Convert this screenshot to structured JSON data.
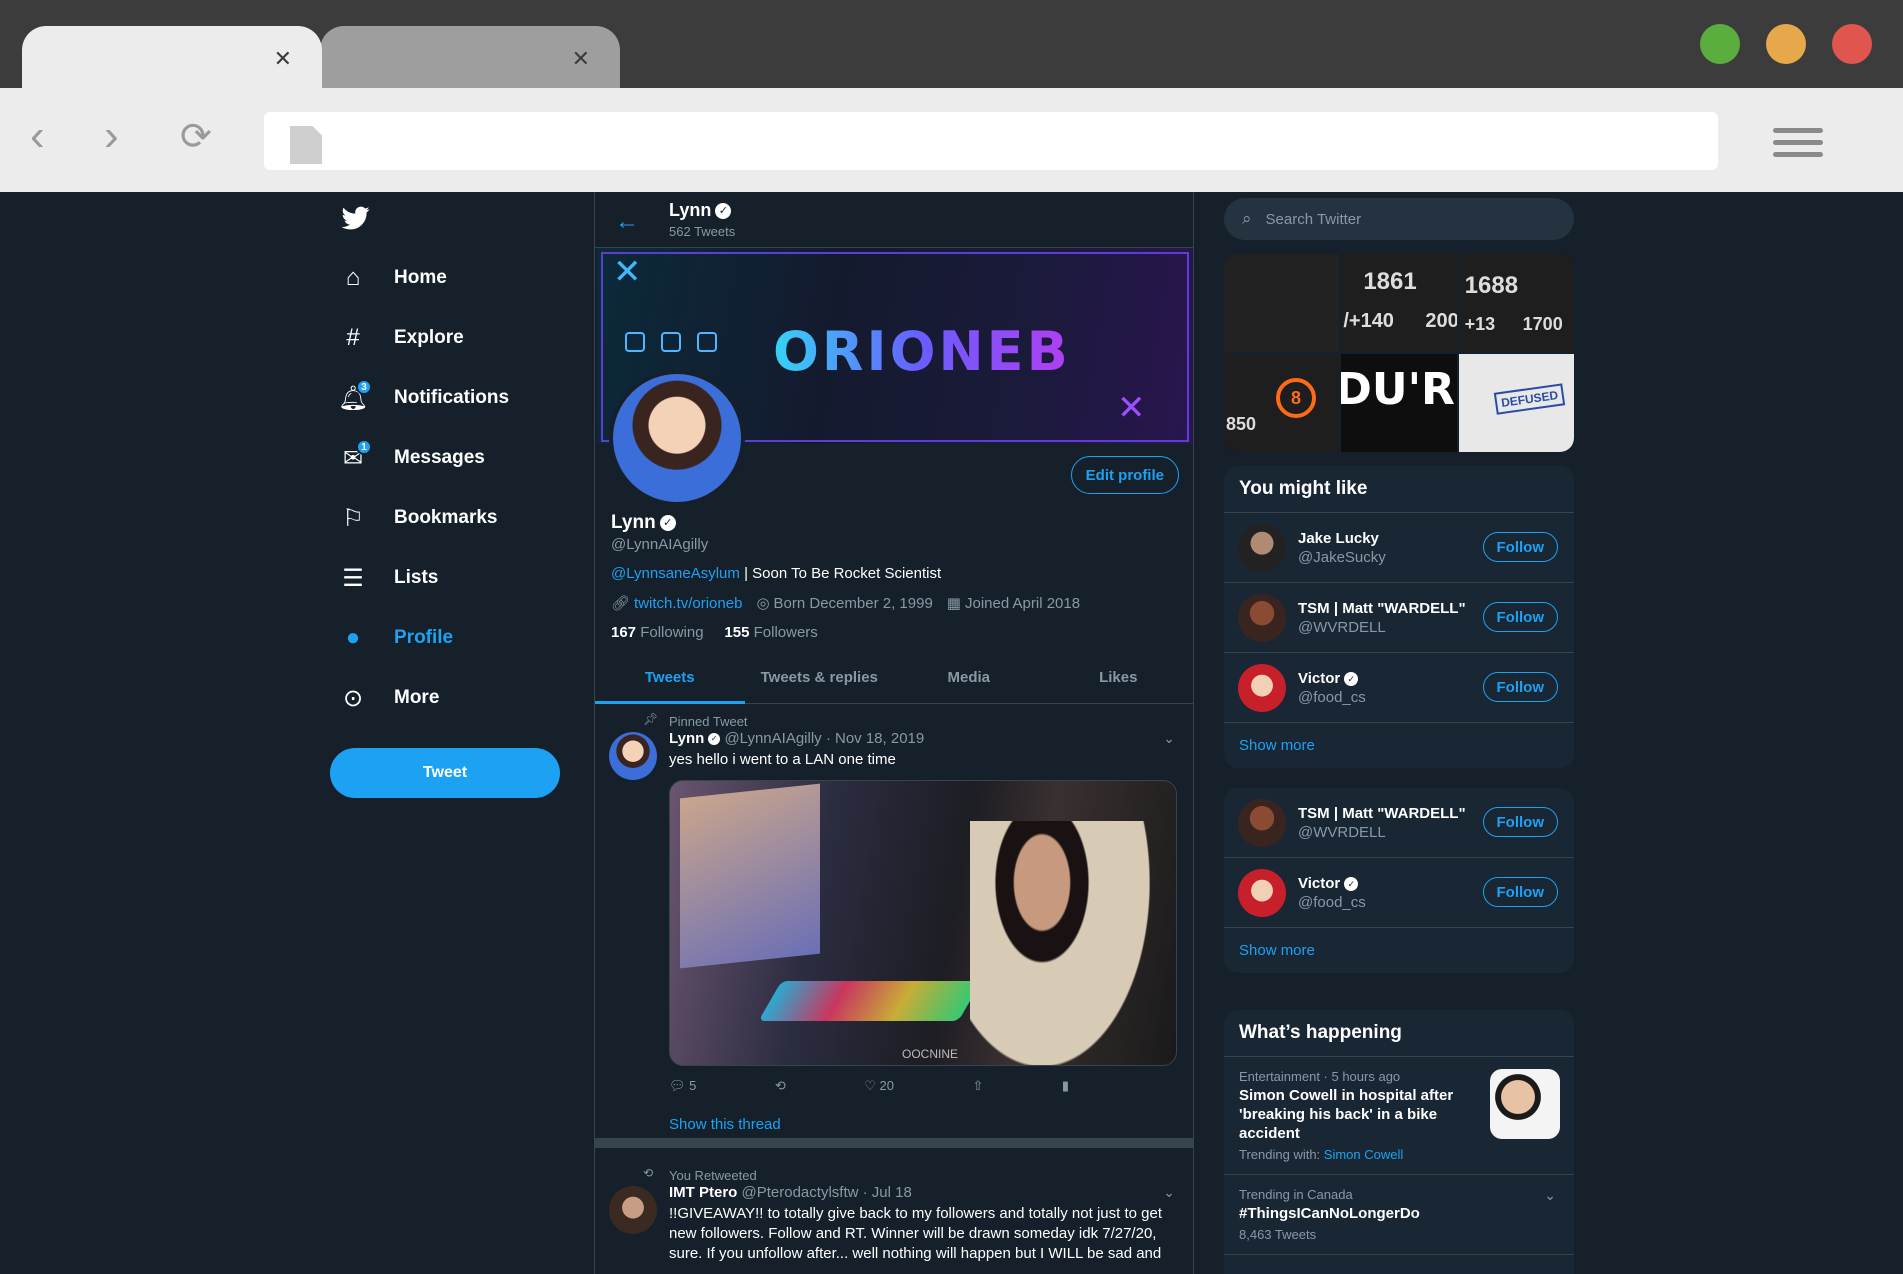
{
  "browser": {
    "colors": {
      "close": "#e0564f",
      "minimize": "#e6a84a",
      "maximize": "#5aae3e"
    }
  },
  "nav": {
    "items": [
      {
        "label": "Home",
        "icon": "home-icon"
      },
      {
        "label": "Explore",
        "icon": "hashtag-icon"
      },
      {
        "label": "Notifications",
        "icon": "bell-icon",
        "badge": "3"
      },
      {
        "label": "Messages",
        "icon": "envelope-icon",
        "badge": "1"
      },
      {
        "label": "Bookmarks",
        "icon": "bookmark-icon"
      },
      {
        "label": "Lists",
        "icon": "list-icon"
      },
      {
        "label": "Profile",
        "icon": "person-icon",
        "active": true
      },
      {
        "label": "More",
        "icon": "more-icon"
      }
    ],
    "tweet_button": "Tweet"
  },
  "header": {
    "name": "Lynn",
    "tweet_count": "562 Tweets"
  },
  "banner": {
    "text": "ORIONEB"
  },
  "profile": {
    "edit_button": "Edit profile",
    "name": "Lynn",
    "handle": "@LynnAIAgilly",
    "bio_link": "@LynnsaneAsylum",
    "bio_text": " | Soon To Be Rocket Scientist",
    "website": "twitch.tv/orioneb",
    "born": "Born December 2, 1999",
    "joined": "Joined April 2018",
    "following_count": "167",
    "following_label": "Following",
    "followers_count": "155",
    "followers_label": "Followers"
  },
  "tabs": [
    "Tweets",
    "Tweets & replies",
    "Media",
    "Likes"
  ],
  "tweets": [
    {
      "context": "Pinned Tweet",
      "name": "Lynn",
      "meta": "@LynnAIAgilly · Nov 18, 2019",
      "text": "yes hello i went to a LAN one time",
      "media_watermark": "OOCNINE",
      "replies": "5",
      "likes": "20",
      "show_thread": "Show this thread"
    },
    {
      "context": "You Retweeted",
      "name": "IMT Ptero",
      "meta": "@Pterodactylsftw · Jul 18",
      "text": "!!GIVEAWAY!! to totally give back to my followers and totally not just to get new followers. Follow and RT. Winner will be drawn someday idk 7/27/20, sure. If you unfollow after... well nothing will happen but I WILL be sad and"
    }
  ],
  "right": {
    "search_placeholder": "Search Twitter",
    "media_grid": {
      "n1": "1861",
      "n2": "1688",
      "n3": "/+140",
      "n4": "200",
      "n5": "+13",
      "n6": "1700",
      "n7": "850",
      "ring": "8",
      "big": "DU'RE IN",
      "defused": "DEFUSED"
    },
    "you_might_like": {
      "title": "You might like",
      "users": [
        {
          "name": "Jake Lucky",
          "handle": "@JakeSucky",
          "button": "Follow"
        },
        {
          "name": "TSM | Matt \"WARDELL\"",
          "handle": "@WVRDELL",
          "button": "Follow"
        },
        {
          "name": "Victor",
          "handle": "@food_cs",
          "button": "Follow",
          "verified": true
        }
      ],
      "show_more": "Show more"
    },
    "second_panel": {
      "users": [
        {
          "name": "TSM | Matt \"WARDELL\"",
          "handle": "@WVRDELL",
          "button": "Follow"
        },
        {
          "name": "Victor",
          "handle": "@food_cs",
          "button": "Follow",
          "verified": true
        }
      ],
      "show_more": "Show more"
    },
    "whats_happening": {
      "title": "What’s happening",
      "trends": [
        {
          "meta": "Entertainment · 5 hours ago",
          "title": "Simon Cowell in hospital after 'breaking his back' in a bike accident",
          "sub_prefix": "Trending with: ",
          "sub_link": "Simon Cowell"
        },
        {
          "meta": "Trending in Canada",
          "title": "#ThingsICanNoLongerDo",
          "sub": "8,463 Tweets"
        }
      ]
    }
  }
}
